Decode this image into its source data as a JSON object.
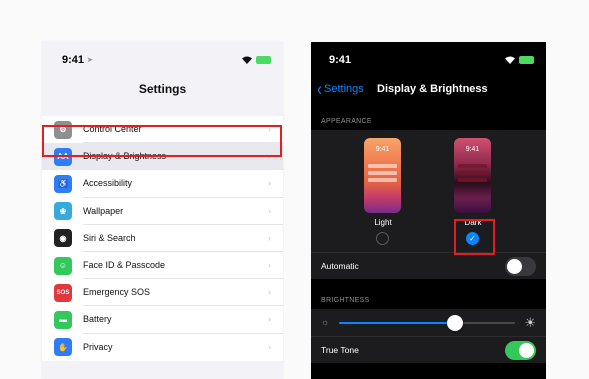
{
  "left_phone": {
    "status": {
      "time": "9:41"
    },
    "title": "Settings",
    "items": [
      {
        "label": "Control Center",
        "icon": "switches-icon",
        "color": "#8e8e93",
        "glyph": "⚙"
      },
      {
        "label": "Display & Brightness",
        "icon": "text-size-icon",
        "color": "#2e7cf6",
        "glyph": "AA"
      },
      {
        "label": "Accessibility",
        "icon": "accessibility-icon",
        "color": "#2e7cf6",
        "glyph": "♿"
      },
      {
        "label": "Wallpaper",
        "icon": "wallpaper-icon",
        "color": "#35aadc",
        "glyph": "❀"
      },
      {
        "label": "Siri & Search",
        "icon": "siri-icon",
        "color": "#222222",
        "glyph": "◉"
      },
      {
        "label": "Face ID & Passcode",
        "icon": "face-id-icon",
        "color": "#34c759",
        "glyph": "☺"
      },
      {
        "label": "Emergency SOS",
        "icon": "sos-icon",
        "color": "#e0383e",
        "glyph": "SOS"
      },
      {
        "label": "Battery",
        "icon": "battery-icon",
        "color": "#34c759",
        "glyph": "▬"
      },
      {
        "label": "Privacy",
        "icon": "hand-icon",
        "color": "#2e7cf6",
        "glyph": "✋"
      }
    ]
  },
  "right_phone": {
    "status": {
      "time": "9:41"
    },
    "nav": {
      "back_label": "Settings",
      "title": "Display & Brightness"
    },
    "appearance_header": "APPEARANCE",
    "light_label": "Light",
    "dark_label": "Dark",
    "thumb_time": "9:41",
    "selected_mode": "Dark",
    "automatic_label": "Automatic",
    "automatic_on": false,
    "brightness_header": "BRIGHTNESS",
    "brightness_level": 0.66,
    "truetone_label": "True Tone",
    "truetone_on": true
  }
}
